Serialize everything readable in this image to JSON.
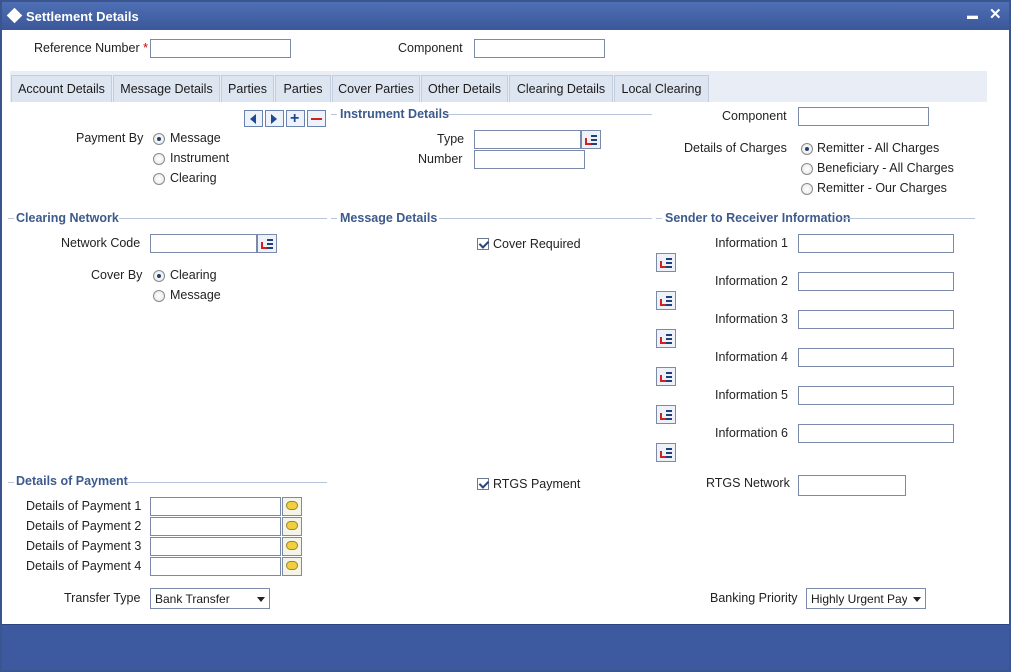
{
  "window": {
    "title": "Settlement Details",
    "minimize": "▬",
    "close": "✕"
  },
  "header": {
    "reference_number_label": "Reference Number",
    "required_mark": "*",
    "reference_number_value": "",
    "component_label": "Component",
    "component_value": ""
  },
  "tabs": [
    {
      "label": "Account Details"
    },
    {
      "label": "Message Details"
    },
    {
      "label": "Parties"
    },
    {
      "label": "Parties"
    },
    {
      "label": "Cover Parties"
    },
    {
      "label": "Other Details"
    },
    {
      "label": "Clearing Details"
    },
    {
      "label": "Local Clearing"
    }
  ],
  "payment_by": {
    "label": "Payment By",
    "options": [
      {
        "label": "Message",
        "selected": true
      },
      {
        "label": "Instrument",
        "selected": false
      },
      {
        "label": "Clearing",
        "selected": false
      }
    ]
  },
  "instrument_details": {
    "title": "Instrument Details",
    "type_label": "Type",
    "type_value": "",
    "number_label": "Number",
    "number_value": ""
  },
  "charges": {
    "component_label": "Component",
    "component_value": "",
    "details_label": "Details of Charges",
    "options": [
      {
        "label": "Remitter - All Charges",
        "selected": true
      },
      {
        "label": "Beneficiary - All Charges",
        "selected": false
      },
      {
        "label": "Remitter - Our Charges",
        "selected": false
      }
    ]
  },
  "clearing_network": {
    "title": "Clearing Network",
    "network_code_label": "Network Code",
    "network_code_value": "",
    "cover_by_label": "Cover By",
    "cover_options": [
      {
        "label": "Clearing",
        "selected": true
      },
      {
        "label": "Message",
        "selected": false
      }
    ]
  },
  "message_details": {
    "title": "Message Details",
    "cover_required_label": "Cover Required",
    "cover_required_checked": true
  },
  "sender_to_receiver": {
    "title": "Sender to Receiver Information",
    "fields": [
      {
        "label": "Information 1",
        "value": ""
      },
      {
        "label": "Information 2",
        "value": ""
      },
      {
        "label": "Information 3",
        "value": ""
      },
      {
        "label": "Information 4",
        "value": ""
      },
      {
        "label": "Information 5",
        "value": ""
      },
      {
        "label": "Information 6",
        "value": ""
      }
    ]
  },
  "details_of_payment": {
    "title": "Details of Payment",
    "fields": [
      {
        "label": "Details of Payment 1",
        "value": ""
      },
      {
        "label": "Details of Payment 2",
        "value": ""
      },
      {
        "label": "Details of Payment 3",
        "value": ""
      },
      {
        "label": "Details of Payment 4",
        "value": ""
      }
    ]
  },
  "rtgs": {
    "payment_label": "RTGS Payment",
    "payment_checked": true,
    "network_label": "RTGS Network",
    "network_value": ""
  },
  "transfer": {
    "label": "Transfer Type",
    "value": "Bank Transfer"
  },
  "banking_priority": {
    "label": "Banking Priority",
    "value": "Highly Urgent Pay"
  },
  "colors": {
    "titlebar": "#3a5799",
    "section_text": "#3c5a8c",
    "tab_bg": "#dde5f1",
    "footer": "#3d5aa0",
    "required": "#cc0000"
  },
  "icons": {
    "lov": "list-of-values-icon",
    "message": "speech-bubble-icon",
    "nav": [
      "arrow-left-icon",
      "arrow-right-icon",
      "plus-icon",
      "minus-icon"
    ]
  }
}
